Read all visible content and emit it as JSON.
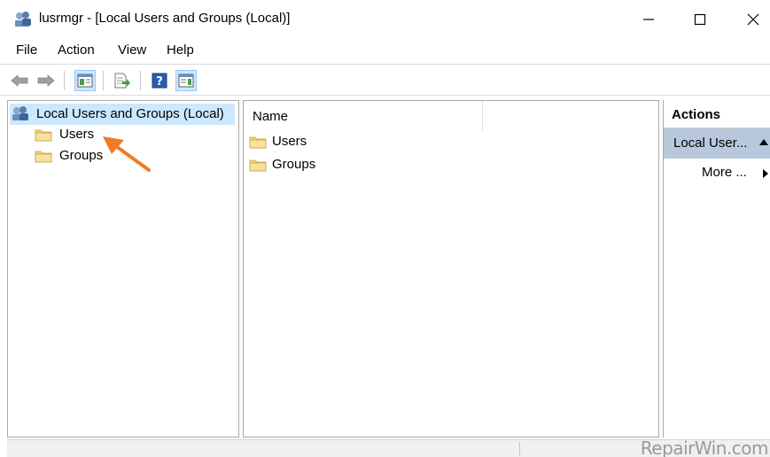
{
  "window": {
    "title": "lusrmgr - [Local Users and Groups (Local)]",
    "icon": "users-groups-icon",
    "controls": [
      "minimize",
      "maximize",
      "close"
    ]
  },
  "menu": {
    "file": "File",
    "action": "Action",
    "view": "View",
    "help": "Help"
  },
  "toolbar": {
    "buttons": [
      "back-icon",
      "forward-icon",
      "show-hide-tree-icon",
      "export-list-icon",
      "help-icon",
      "show-hide-action-pane-icon"
    ]
  },
  "tree": {
    "root": "Local Users and Groups (Local)",
    "items": [
      {
        "label": "Users"
      },
      {
        "label": "Groups"
      }
    ]
  },
  "list": {
    "column_name": "Name",
    "items": [
      {
        "label": "Users"
      },
      {
        "label": "Groups"
      }
    ]
  },
  "actions": {
    "title": "Actions",
    "group": "Local User...",
    "more": "More ..."
  },
  "watermark": "RepairWin.com",
  "colors": {
    "selection": "#cce8ff",
    "actions_group": "#b7c8dc",
    "annotation_arrow": "#f07c26",
    "folder": "#f2d27a"
  }
}
